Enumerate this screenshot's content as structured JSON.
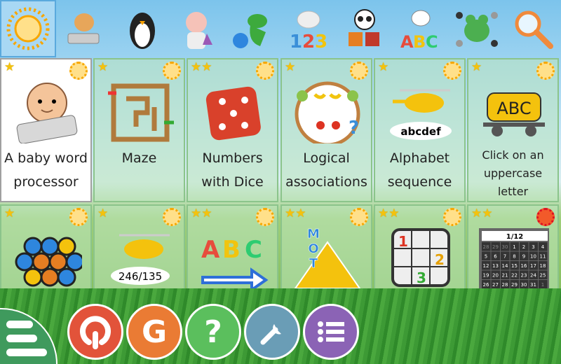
{
  "categories": [
    {
      "name": "all",
      "icon": "sun-icon",
      "selected": true
    },
    {
      "name": "computer",
      "icon": "cat-keyboard-icon"
    },
    {
      "name": "discovery",
      "icon": "penguin-icon"
    },
    {
      "name": "experiment",
      "icon": "pig-chemist-icon"
    },
    {
      "name": "fun",
      "icon": "dinosaur-ball-icon"
    },
    {
      "name": "math",
      "icon": "sheep-123-icon",
      "text": "123"
    },
    {
      "name": "puzzle",
      "icon": "panda-puzzle-icon"
    },
    {
      "name": "reading",
      "icon": "cow-abc-icon",
      "text": "ABC"
    },
    {
      "name": "strategy",
      "icon": "frog-icon"
    },
    {
      "name": "search",
      "icon": "magnifier-icon"
    }
  ],
  "activities": [
    {
      "label": "A baby word processor",
      "stars": 1,
      "selected": true,
      "icon": "baby-keyboard-icon"
    },
    {
      "label": "Maze",
      "stars": 1,
      "icon": "maze-icon"
    },
    {
      "label": "Numbers with Dice",
      "stars": 2,
      "icon": "dice-icon"
    },
    {
      "label": "Logical associations",
      "stars": 1,
      "icon": "fruit-plate-icon"
    },
    {
      "label": "Alphabet sequence",
      "stars": 1,
      "icon": "helicopter-icon",
      "text": "abcdef"
    },
    {
      "label": "Click on an uppercase letter",
      "stars": 1,
      "icon": "abc-wagon-icon",
      "text": "ABC"
    },
    {
      "label": "",
      "stars": 1,
      "icon": "hexagon-icon"
    },
    {
      "label": "",
      "stars": 1,
      "icon": "helicopter-numbers-icon",
      "text": "246/135"
    },
    {
      "label": "",
      "stars": 2,
      "icon": "abc-arrow-icon",
      "text": "ABC"
    },
    {
      "label": "",
      "stars": 2,
      "icon": "letter-pyramid-icon",
      "text": "MOT"
    },
    {
      "label": "",
      "stars": 2,
      "icon": "sudoku-icon",
      "text": "1 2 3"
    },
    {
      "label": "",
      "stars": 3,
      "icon": "calendar-icon",
      "text": "1/12"
    }
  ],
  "bottom_bar": [
    {
      "name": "exit",
      "icon": "power-icon",
      "color": "#e2533a"
    },
    {
      "name": "about",
      "icon": "gcompris-g-icon",
      "color": "#ea7b34",
      "text": "G"
    },
    {
      "name": "help",
      "icon": "question-icon",
      "color": "#5bbf5d",
      "text": "?"
    },
    {
      "name": "settings",
      "icon": "wrench-icon",
      "color": "#6a9db6"
    },
    {
      "name": "activity-config",
      "icon": "list-icon",
      "color": "#8b63b5"
    }
  ],
  "colors": {
    "star": "#f4c20d",
    "selected_category": "#a8d8f4"
  }
}
